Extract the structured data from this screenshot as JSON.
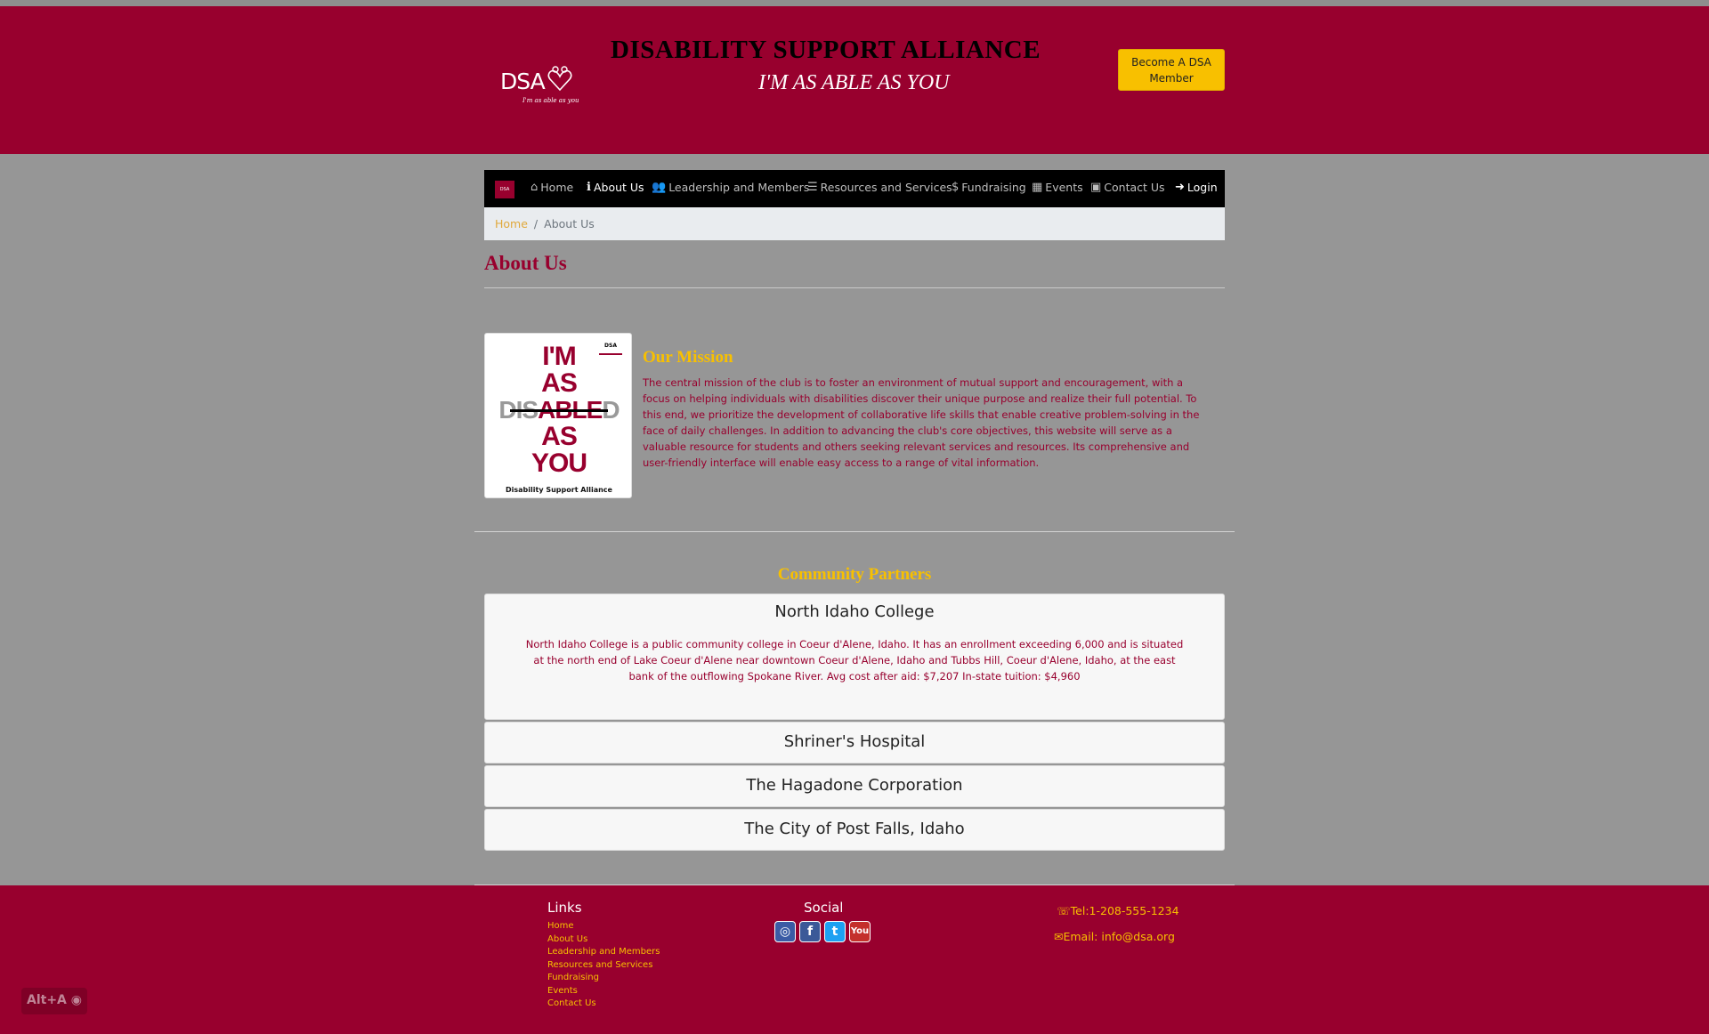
{
  "header": {
    "logo_text": "DSA",
    "logo_tagline": "I'm as able as you",
    "title": "DISABILITY SUPPORT ALLIANCE",
    "slogan": "I'M AS ABLE AS YOU",
    "member_button": "Become A DSA Member",
    "accent_color": "#98002e",
    "button_color": "#f8c000"
  },
  "nav": {
    "brand": "DSA",
    "items": [
      {
        "label": "Home",
        "icon": "home-icon"
      },
      {
        "label": "About Us",
        "icon": "info-icon",
        "active": true
      },
      {
        "label": "Leadership and Members",
        "icon": "users-icon"
      },
      {
        "label": "Resources and Services",
        "icon": "list-icon"
      },
      {
        "label": "Fundraising",
        "icon": "dollar-icon"
      },
      {
        "label": "Events",
        "icon": "calendar-icon"
      },
      {
        "label": "Contact Us",
        "icon": "id-card-icon"
      },
      {
        "label": "Login",
        "icon": "sign-in-icon"
      }
    ]
  },
  "breadcrumb": {
    "home": "Home",
    "current": "About Us"
  },
  "page": {
    "title": "About Us"
  },
  "poster": {
    "lines": [
      "I'M",
      "AS",
      "DISABLED",
      "AS",
      "YOU"
    ],
    "footer": "Disability Support Alliance"
  },
  "mission": {
    "heading": "Our Mission",
    "text": "The central mission of the club is to foster an environment of mutual support and encouragement, with a focus on helping individuals with disabilities discover their unique purpose and realize their full potential. To this end, we prioritize the development of collaborative life skills that enable creative problem-solving in the face of daily challenges. In addition to advancing the club's core objectives, this website will serve as a valuable resource for students and others seeking relevant services and resources. Its comprehensive and user-friendly interface will enable easy access to a range of vital information."
  },
  "partners": {
    "heading": "Community Partners",
    "items": [
      {
        "name": "North Idaho College",
        "text": "North Idaho College is a public community college in Coeur d'Alene, Idaho. It has an enrollment exceeding 6,000 and is situated at the north end of Lake Coeur d'Alene near downtown Coeur d'Alene, Idaho and Tubbs Hill, Coeur d'Alene, Idaho, at the east bank of the outflowing Spokane River. Avg cost after aid: $7,207 In-state tuition: $4,960"
      },
      {
        "name": "Shriner's Hospital"
      },
      {
        "name": "The Hagadone Corporation"
      },
      {
        "name": "The City of Post Falls, Idaho"
      }
    ]
  },
  "footer": {
    "links_heading": "Links",
    "links": [
      "Home",
      "About Us",
      "Leadership and Members",
      "Resources and Services",
      "Fundraising",
      "Events",
      "Contact Us"
    ],
    "social_heading": "Social",
    "social": [
      "instagram-icon",
      "facebook-icon",
      "twitter-icon",
      "youtube-icon"
    ],
    "phone": "Tel:1-208-555-1234",
    "email": "Email: info@dsa.org"
  },
  "widget": {
    "label": "Alt+A"
  }
}
